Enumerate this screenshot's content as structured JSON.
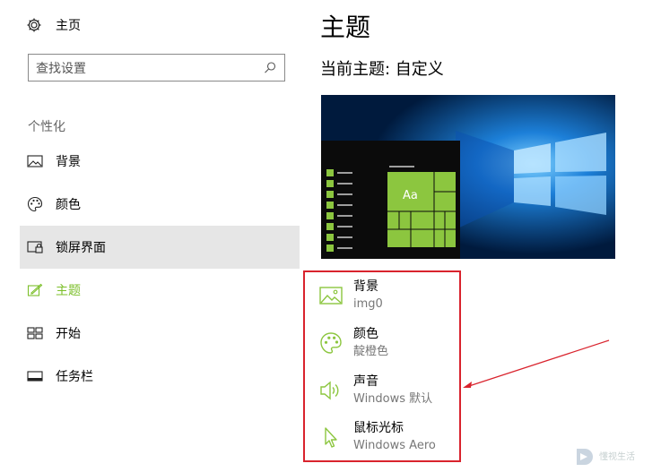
{
  "sidebar": {
    "home_label": "主页",
    "search_placeholder": "查找设置",
    "section_label": "个性化",
    "items": [
      {
        "label": "背景",
        "icon": "picture-icon"
      },
      {
        "label": "颜色",
        "icon": "palette-icon"
      },
      {
        "label": "锁屏界面",
        "icon": "lock-screen-icon"
      },
      {
        "label": "主题",
        "icon": "theme-brush-icon"
      },
      {
        "label": "开始",
        "icon": "start-tiles-icon"
      },
      {
        "label": "任务栏",
        "icon": "taskbar-icon"
      }
    ]
  },
  "main": {
    "title": "主题",
    "current_theme": "当前主题: 自定义",
    "preview_tile_text": "Aa",
    "options": [
      {
        "title": "背景",
        "value": "img0",
        "icon": "picture-icon"
      },
      {
        "title": "颜色",
        "value": "靛橙色",
        "icon": "palette-icon"
      },
      {
        "title": "声音",
        "value": "Windows 默认",
        "icon": "speaker-icon"
      },
      {
        "title": "鼠标光标",
        "value": "Windows Aero",
        "icon": "cursor-icon"
      }
    ]
  },
  "watermark": {
    "text": "懂视生活"
  },
  "colors": {
    "accent": "#8cc63f",
    "active_nav": "#7cbf2a",
    "highlight_border": "#d9232d",
    "hover_bg": "#e6e6e6",
    "preview_bg": "#00193a"
  }
}
